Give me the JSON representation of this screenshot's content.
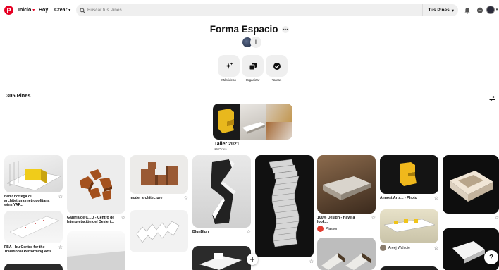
{
  "header": {
    "logo": "P",
    "home_label": "Inicio",
    "today_label": "Hoy",
    "create_label": "Crear",
    "search_placeholder": "Buscar tus Pines",
    "search_scope": "Tus Pines"
  },
  "board": {
    "title": "Forma Espacio",
    "more": "···",
    "actions": [
      {
        "label": "Más ideas",
        "icon": "sparkle-icon"
      },
      {
        "label": "Organizar",
        "icon": "organize-icon"
      },
      {
        "label": "Tareas",
        "icon": "checkmark-icon"
      }
    ],
    "pin_count": "305 Pines"
  },
  "section": {
    "name": "Taller 2021",
    "sub": "16 Pines"
  },
  "pins": [
    {
      "title": "bam! bottega di architettura metropolitana wins YAP..."
    },
    {
      "title": "FBA | Izu Centre for the Traditional Performing Arts"
    },
    {
      "title": "Galería de C.I.D - Centro de Interpretación del Desiert..."
    },
    {
      "title": "model architecture"
    },
    {
      "title": "BlunBlun"
    },
    {
      "title": "100% Design - Have a look..."
    },
    {
      "title": "Almost Arts... - Photo"
    }
  ],
  "owners": [
    {
      "name": "Plasson"
    },
    {
      "name": "Areej Wahidie"
    }
  ],
  "colors": {
    "brand": "#e60023",
    "chip": "#efefef"
  }
}
